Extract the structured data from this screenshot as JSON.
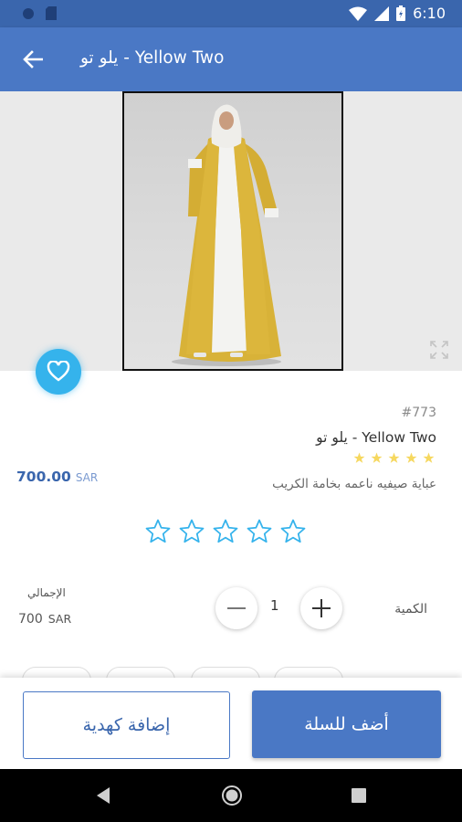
{
  "status_bar": {
    "time": "6:10",
    "icons": [
      "sim-icon",
      "sd-card-icon",
      "wifi-icon",
      "signal-icon",
      "battery-icon"
    ]
  },
  "app_bar": {
    "title": "يلو تو - Yellow Two",
    "back_icon": "arrow-left-icon"
  },
  "product": {
    "sku": "#773",
    "name": "يلو تو - Yellow Two",
    "description": "عباية صيفيه ناعمه بخامة الكريب",
    "price_value": "700.00",
    "price_currency": "SAR",
    "mini_rating": 5,
    "user_rating": 0
  },
  "quantity": {
    "label": "الكمية",
    "value": "1",
    "minus_symbol": "−",
    "plus_symbol": "+"
  },
  "total": {
    "label": "الإجمالي",
    "value": "700",
    "currency": "SAR"
  },
  "actions": {
    "add_to_cart": "أضف للسلة",
    "add_as_gift": "إضافة كهدية"
  },
  "colors": {
    "primary": "#4a78c5",
    "status_bar": "#3a66ad",
    "favorite": "#35b3ec",
    "star_gold": "#f6d860",
    "star_outline": "#35b3ec"
  }
}
